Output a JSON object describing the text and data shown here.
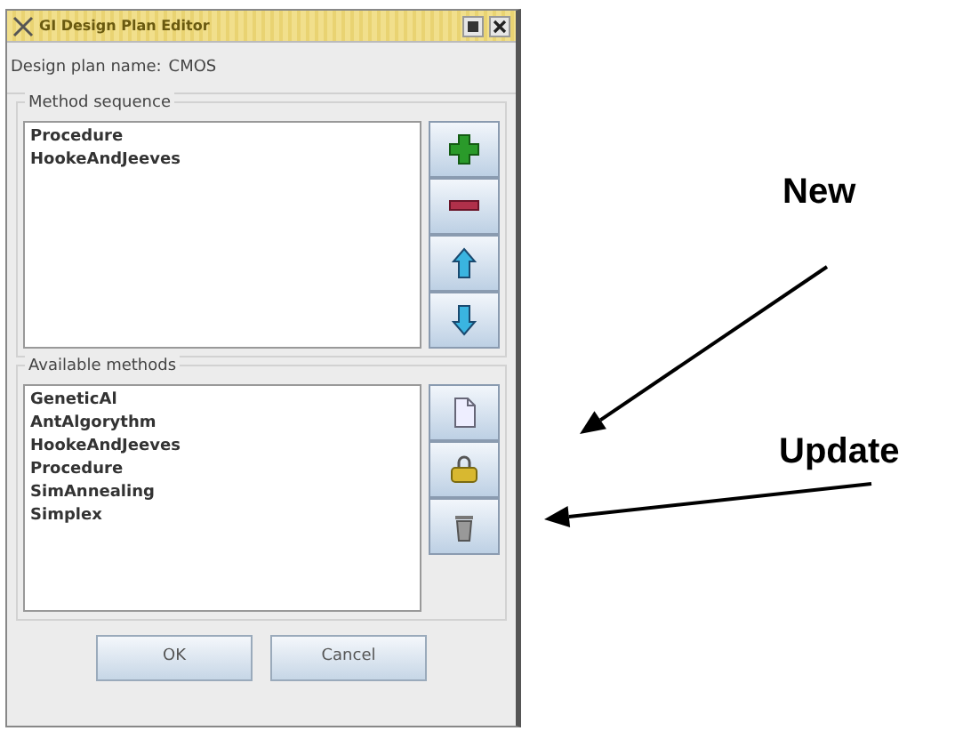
{
  "window": {
    "title": "GI Design Plan Editor"
  },
  "design_plan": {
    "label": "Design plan name:",
    "value": "CMOS"
  },
  "method_sequence": {
    "title": "Method sequence",
    "items": [
      "Procedure",
      "HookeAndJeeves"
    ],
    "tools": [
      {
        "kind": "add"
      },
      {
        "kind": "remove"
      },
      {
        "kind": "up"
      },
      {
        "kind": "down"
      }
    ]
  },
  "available_methods": {
    "title": "Available methods",
    "items": [
      "GeneticAl",
      "AntAlgorythm",
      "HookeAndJeeves",
      "Procedure",
      "SimAnnealing",
      "Simplex"
    ],
    "tools": [
      {
        "kind": "new"
      },
      {
        "kind": "update"
      },
      {
        "kind": "delete"
      }
    ]
  },
  "buttons": [
    "OK",
    "Cancel"
  ],
  "annotations": [
    {
      "label": "New"
    },
    {
      "label": "Update"
    }
  ]
}
